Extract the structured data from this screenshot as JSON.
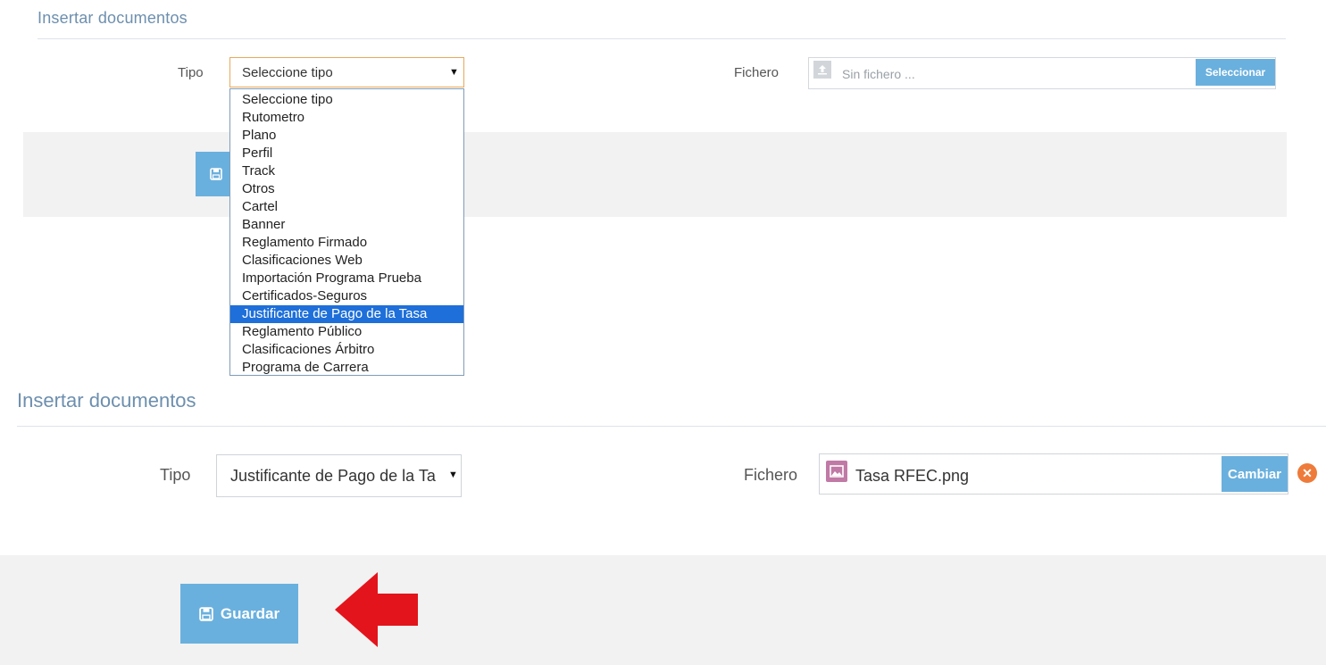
{
  "top_form": {
    "section_title": "Insertar documentos",
    "tipo_label": "Tipo",
    "tipo_value": "Seleccione tipo",
    "fichero_label": "Fichero",
    "file_placeholder": "Sin fichero ...",
    "select_button": "Seleccionar",
    "dropdown_options": [
      "Seleccione tipo",
      "Rutometro",
      "Plano",
      "Perfil",
      "Track",
      "Otros",
      "Cartel",
      "Banner",
      "Reglamento Firmado",
      "Clasificaciones Web",
      "Importación Programa Prueba",
      "Certificados-Seguros",
      "Justificante de Pago de la Tasa",
      "Reglamento Público",
      "Clasificaciones Árbitro",
      "Programa de Carrera"
    ],
    "highlighted_option": "Justificante de Pago de la Tasa"
  },
  "bottom_form": {
    "section_title": "Insertar documentos",
    "tipo_label": "Tipo",
    "tipo_value": "Justificante de Pago de la Ta",
    "fichero_label": "Fichero",
    "file_name": "Tasa RFEC.png",
    "change_button": "Cambiar",
    "save_button": "Guardar"
  },
  "icons": {
    "upload": "upload-icon",
    "image": "image-file-icon",
    "remove": "remove-icon",
    "save": "floppy-disk-icon",
    "arrow": "red-arrow-annotation"
  },
  "colors": {
    "accent_blue": "#6ab0de",
    "title_blue": "#6d8fae",
    "highlight": "#1e6fd9",
    "remove_orange": "#ee7b3a",
    "arrow_red": "#e3141b"
  }
}
